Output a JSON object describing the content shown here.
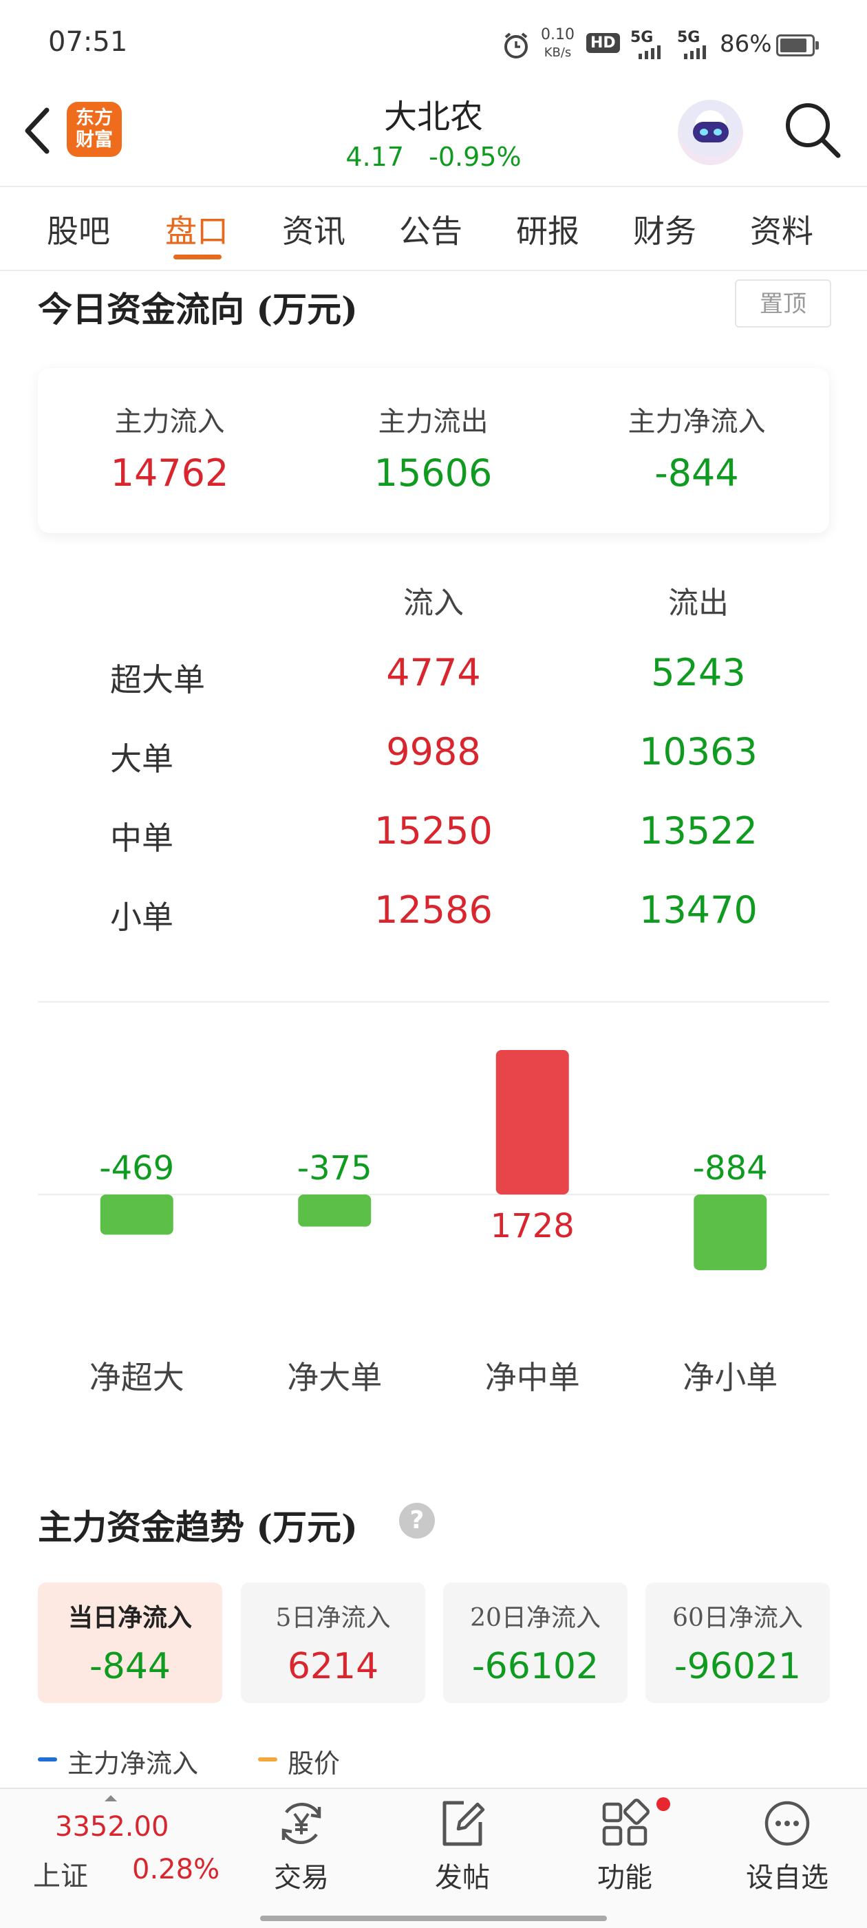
{
  "status_bar": {
    "time": "07:51",
    "net_speed": "0.10",
    "net_unit": "KB/s",
    "hd": "HD",
    "sig1": "5G",
    "sig2": "5G",
    "battery": "86%"
  },
  "header": {
    "logo_line1": "东方",
    "logo_line2": "财富",
    "stock_name": "大北农",
    "price": "4.17",
    "change_pct": "-0.95%"
  },
  "tabs": [
    "股吧",
    "盘口",
    "资讯",
    "公告",
    "研报",
    "财务",
    "资料"
  ],
  "active_tab_index": 1,
  "fund_flow": {
    "title": "今日资金流向 (万元)",
    "pin_label": "置顶",
    "summary": [
      {
        "label": "主力流入",
        "value": "14762",
        "color": "red"
      },
      {
        "label": "主力流出",
        "value": "15606",
        "color": "green"
      },
      {
        "label": "主力净流入",
        "value": "-844",
        "color": "green"
      }
    ],
    "table_headers": [
      "流入",
      "流出"
    ],
    "rows": [
      {
        "label": "超大单",
        "inflow": "4774",
        "outflow": "5243"
      },
      {
        "label": "大单",
        "inflow": "9988",
        "outflow": "10363"
      },
      {
        "label": "中单",
        "inflow": "15250",
        "outflow": "13522"
      },
      {
        "label": "小单",
        "inflow": "12586",
        "outflow": "13470"
      }
    ]
  },
  "chart_data": {
    "type": "bar",
    "categories": [
      "净超大",
      "净大单",
      "净中单",
      "净小单"
    ],
    "values": [
      -469,
      -375,
      1728,
      -884
    ],
    "value_labels": [
      "-469",
      "-375",
      "1728",
      "-884"
    ],
    "title": "",
    "xlabel": "",
    "ylabel": "",
    "positive_color": "#e8454b",
    "negative_color": "#5cbf47",
    "grid": false
  },
  "trend": {
    "title": "主力资金趋势 (万元)",
    "help_symbol": "?",
    "periods": [
      {
        "label": "当日净流入",
        "value": "-844",
        "color": "green"
      },
      {
        "label": "5日净流入",
        "value": "6214",
        "color": "red"
      },
      {
        "label": "20日净流入",
        "value": "-66102",
        "color": "green"
      },
      {
        "label": "60日净流入",
        "value": "-96021",
        "color": "green"
      }
    ],
    "legend": [
      {
        "label": "主力净流入",
        "color": "#1e6fd6"
      },
      {
        "label": "股价",
        "color": "#f2a93b"
      }
    ]
  },
  "bottom_bar": {
    "index_price": "3352.00",
    "index_name": "上证",
    "index_change": "0.28%",
    "nav": [
      {
        "label": "交易",
        "icon": "yen-exchange-icon"
      },
      {
        "label": "发帖",
        "icon": "edit-post-icon"
      },
      {
        "label": "功能",
        "icon": "grid-apps-icon"
      },
      {
        "label": "设自选",
        "icon": "more-dots-icon"
      }
    ]
  }
}
